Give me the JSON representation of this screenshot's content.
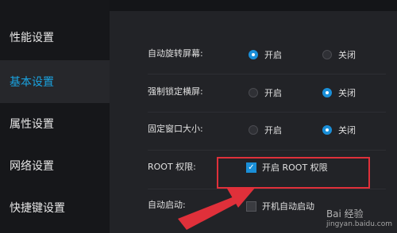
{
  "sidebar": {
    "items": [
      {
        "label": "性能设置"
      },
      {
        "label": "基本设置"
      },
      {
        "label": "属性设置"
      },
      {
        "label": "网络设置"
      },
      {
        "label": "快捷键设置"
      }
    ]
  },
  "settings": {
    "auto_rotate": {
      "label": "自动旋转屏幕:",
      "on": "开启",
      "off": "关闭",
      "selected": "开启"
    },
    "force_landscape": {
      "label": "强制锁定横屏:",
      "on": "开启",
      "off": "关闭",
      "selected": "关闭"
    },
    "fixed_window": {
      "label": "固定窗口大小:",
      "on": "开启",
      "off": "关闭",
      "selected": "关闭"
    },
    "root": {
      "label": "ROOT 权限:",
      "checkbox_label": "开启 ROOT 权限",
      "checked": true
    },
    "autostart": {
      "label": "自动启动:",
      "checkbox_label": "开机自动启动",
      "checked": false
    }
  },
  "watermark": {
    "brand": "Bai 经验",
    "url": "jingyan.baidu.com"
  },
  "colors": {
    "accent": "#1a8fd8",
    "annotation": "#e0303a",
    "active_nav_text": "#1aa3e0"
  }
}
